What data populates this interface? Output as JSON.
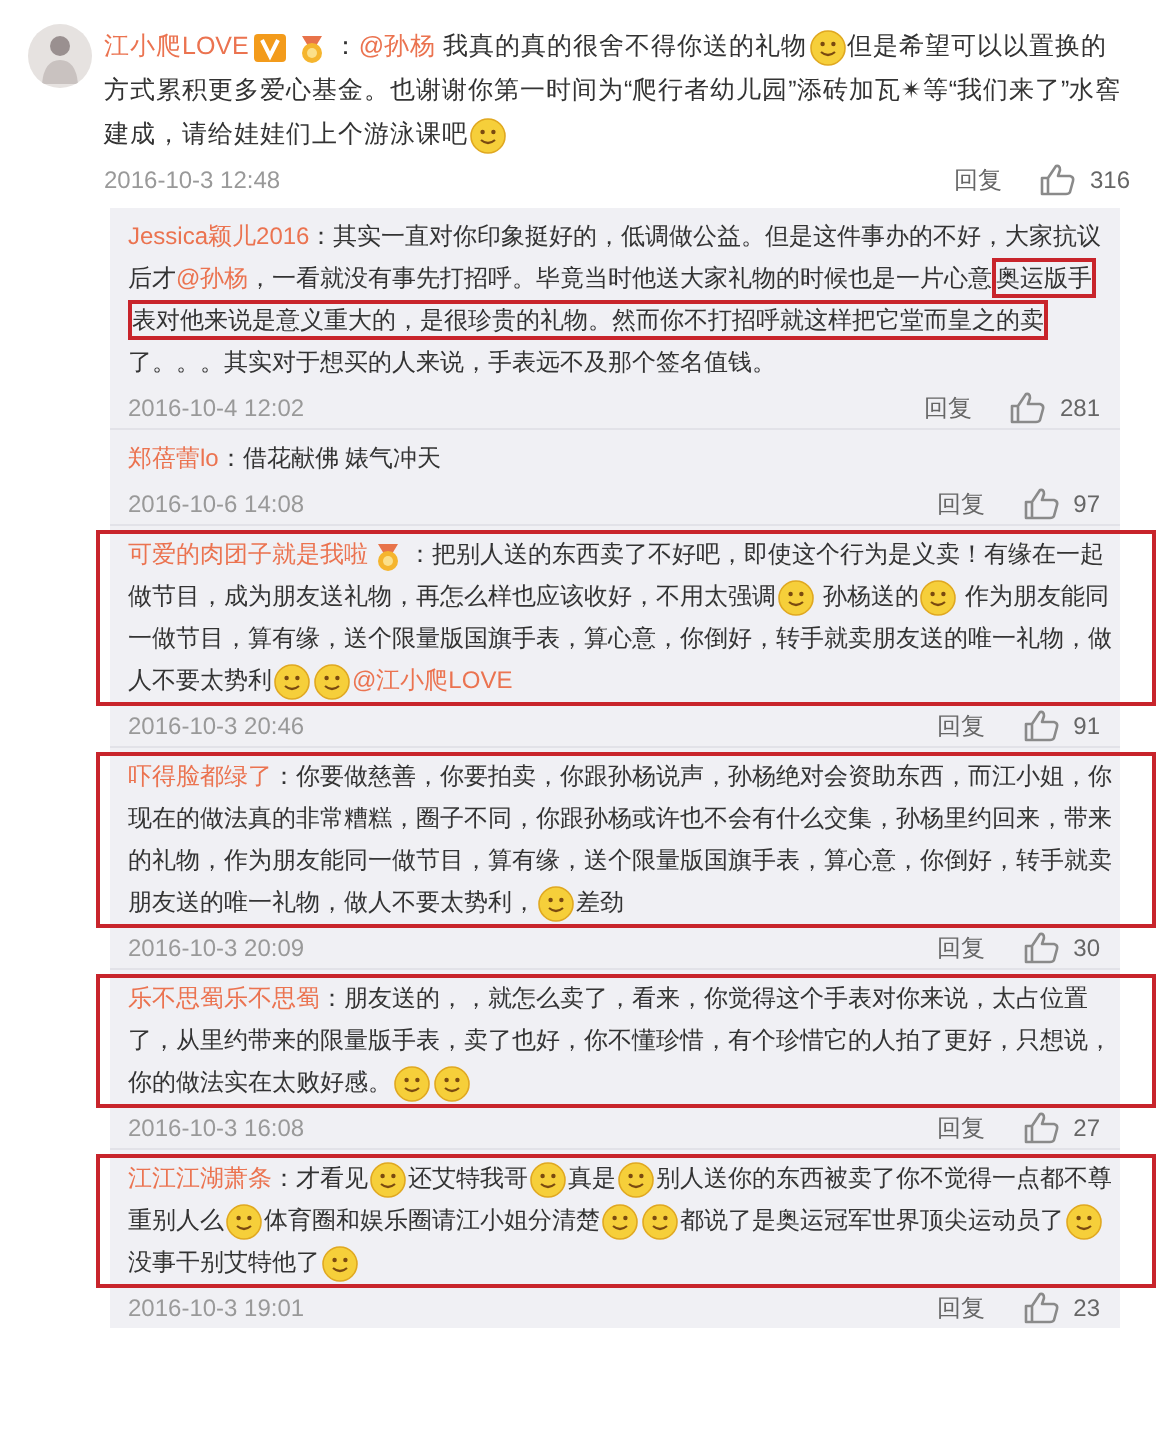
{
  "comment": {
    "author": "江小爬LOVE",
    "verified": true,
    "member_badge": true,
    "parts": [
      {
        "kind": "text",
        "text": "："
      },
      {
        "kind": "mention",
        "text": "@孙杨"
      },
      {
        "kind": "text",
        "text": " 我真的真的很舍不得你送的礼物"
      },
      {
        "kind": "emoji"
      },
      {
        "kind": "text",
        "text": "但是希望可以以置换的方式累积更多爱心基金。也谢谢你第一时间为“爬行者幼儿园”添砖加瓦✴等“我们来了”水窖建成，请给娃娃们上个游泳课吧"
      },
      {
        "kind": "emoji"
      }
    ],
    "time": "2016-10-3 12:48",
    "reply_label": "回复",
    "likes": "316"
  },
  "replies": [
    {
      "author": "Jessica颖儿2016",
      "member_badge": false,
      "highlighted": false,
      "parts": [
        {
          "kind": "text",
          "text": "：其实一直对你印象挺好的，低调做公益。但是这件事办的不好，大家抗议后才"
        },
        {
          "kind": "mention",
          "text": "@孙杨"
        },
        {
          "kind": "text",
          "text": "，一看就没有事先打招呼。毕竟当时他送大家礼物的时候也是一片心意"
        },
        {
          "kind": "marked",
          "text": "奥运版手"
        },
        {
          "kind": "marked",
          "text": "表对他来说是意义重大的，是很珍贵的礼物。然而你不打招呼就这样把它堂而皇之的卖"
        },
        {
          "kind": "text",
          "text": "了。。。其实对于想买的人来说，手表远不及那个签名值钱。"
        }
      ],
      "time": "2016-10-4 12:02",
      "reply_label": "回复",
      "likes": "281"
    },
    {
      "author": "郑蓓蕾lo",
      "member_badge": false,
      "highlighted": false,
      "parts": [
        {
          "kind": "text",
          "text": "：借花献佛 婊气冲天"
        }
      ],
      "time": "2016-10-6 14:08",
      "reply_label": "回复",
      "likes": "97"
    },
    {
      "author": "可爱的肉团子就是我啦",
      "member_badge": true,
      "highlighted": true,
      "parts": [
        {
          "kind": "text",
          "text": "：把别人送的东西卖了不好吧，即使这个行为是义卖！有缘在一起做节目，成为朋友送礼物，再怎么样也应该收好，不用太强调"
        },
        {
          "kind": "emoji"
        },
        {
          "kind": "text",
          "text": " 孙杨送的"
        },
        {
          "kind": "emoji"
        },
        {
          "kind": "text",
          "text": " 作为朋友能同一做节目，算有缘，送个限量版国旗手表，算心意，你倒好，转手就卖朋友送的唯一礼物，做人不要太势利"
        },
        {
          "kind": "emoji"
        },
        {
          "kind": "emoji"
        },
        {
          "kind": "mention",
          "text": "@江小爬LOVE"
        }
      ],
      "time": "2016-10-3 20:46",
      "reply_label": "回复",
      "likes": "91"
    },
    {
      "author": "吓得脸都绿了",
      "member_badge": false,
      "highlighted": true,
      "parts": [
        {
          "kind": "text",
          "text": "：你要做慈善，你要拍卖，你跟孙杨说声，孙杨绝对会资助东西，而江小姐，你现在的做法真的非常糟糕，圈子不同，你跟孙杨或许也不会有什么交集，孙杨里约回来，带来的礼物，作为朋友能同一做节目，算有缘，送个限量版国旗手表，算心意，你倒好，转手就卖朋友送的唯一礼物，做人不要太势利，"
        },
        {
          "kind": "emoji"
        },
        {
          "kind": "text",
          "text": "差劲"
        }
      ],
      "time": "2016-10-3 20:09",
      "reply_label": "回复",
      "likes": "30"
    },
    {
      "author": "乐不思蜀乐不思蜀",
      "member_badge": false,
      "highlighted": true,
      "parts": [
        {
          "kind": "text",
          "text": "：朋友送的，，就怎么卖了，看来，你觉得这个手表对你来说，太占位置了，从里约带来的限量版手表，卖了也好，你不懂珍惜，有个珍惜它的人拍了更好，只想说，你的做法实在太败好感。"
        },
        {
          "kind": "emoji"
        },
        {
          "kind": "emoji"
        }
      ],
      "time": "2016-10-3 16:08",
      "reply_label": "回复",
      "likes": "27"
    },
    {
      "author": "江江江湖萧条",
      "member_badge": false,
      "highlighted": true,
      "parts": [
        {
          "kind": "text",
          "text": "：才看见"
        },
        {
          "kind": "emoji"
        },
        {
          "kind": "text",
          "text": "还艾特我哥"
        },
        {
          "kind": "emoji"
        },
        {
          "kind": "text",
          "text": "真是"
        },
        {
          "kind": "emoji"
        },
        {
          "kind": "text",
          "text": "别人送你的东西被卖了你不觉得一点都不尊重别人么"
        },
        {
          "kind": "emoji"
        },
        {
          "kind": "text",
          "text": "体育圈和娱乐圈请江小姐分清楚"
        },
        {
          "kind": "emoji"
        },
        {
          "kind": "emoji"
        },
        {
          "kind": "text",
          "text": "都说了是奥运冠军世界顶尖运动员了"
        },
        {
          "kind": "emoji"
        },
        {
          "kind": "text",
          "text": "没事干别艾特他了"
        },
        {
          "kind": "emoji"
        }
      ],
      "time": "2016-10-3 19:01",
      "reply_label": "回复",
      "likes": "23"
    }
  ]
}
